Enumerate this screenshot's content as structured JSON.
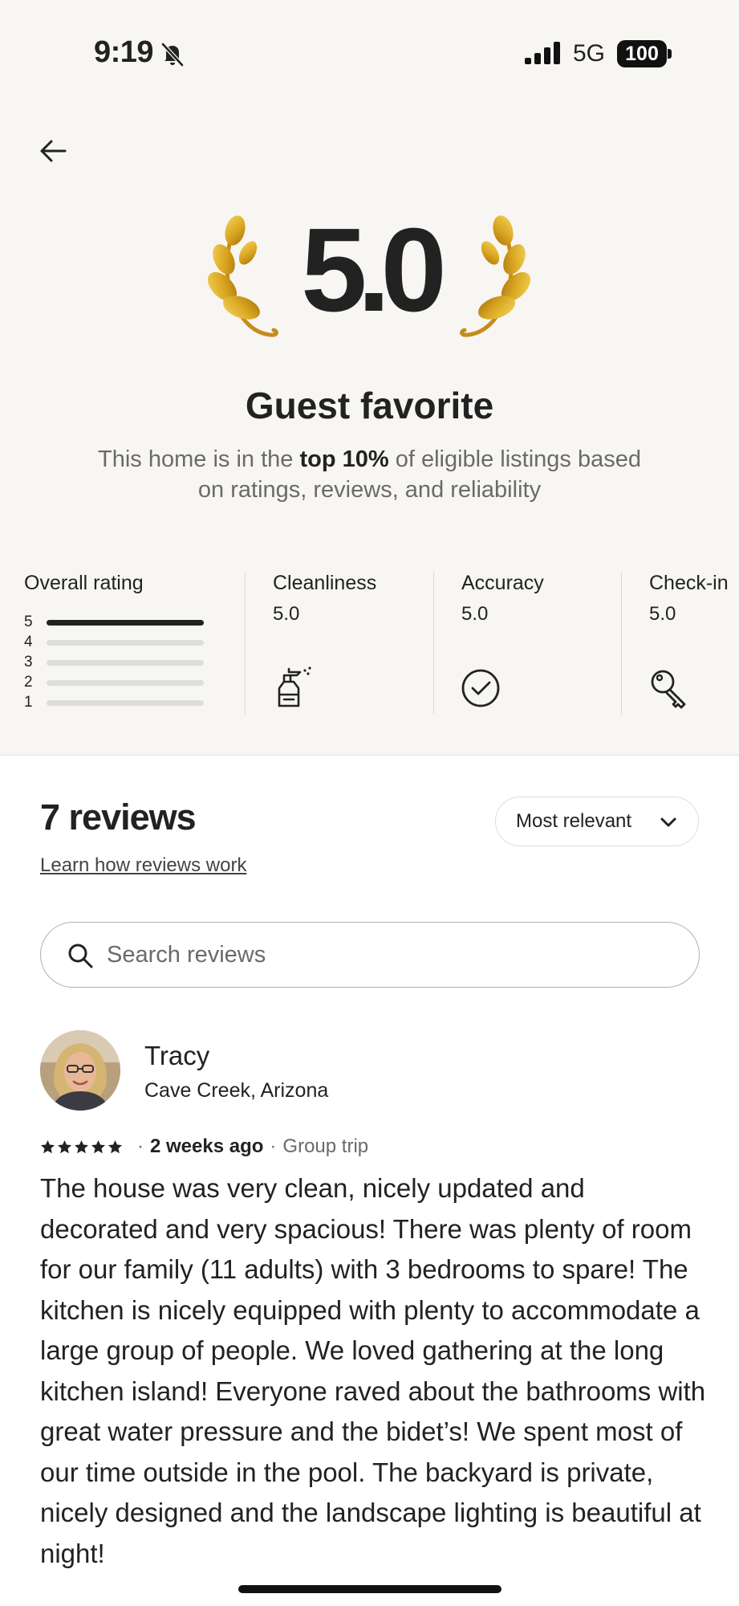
{
  "status_bar": {
    "time": "9:19",
    "network": "5G",
    "battery": "100"
  },
  "hero": {
    "rating": "5.0",
    "title": "Guest favorite",
    "desc_before": "This home is in the ",
    "desc_bold": "top 10%",
    "desc_after": " of eligible listings based on ratings, reviews, and reliability"
  },
  "ratings": {
    "overall_label": "Overall rating",
    "distribution": [
      {
        "stars": "5",
        "fraction": 1.0
      },
      {
        "stars": "4",
        "fraction": 0
      },
      {
        "stars": "3",
        "fraction": 0
      },
      {
        "stars": "2",
        "fraction": 0
      },
      {
        "stars": "1",
        "fraction": 0
      }
    ],
    "categories": [
      {
        "label": "Cleanliness",
        "value": "5.0",
        "icon": "spray-bottle-icon"
      },
      {
        "label": "Accuracy",
        "value": "5.0",
        "icon": "check-circle-icon"
      },
      {
        "label": "Check-in",
        "value": "5.0",
        "icon": "key-icon"
      }
    ]
  },
  "reviews": {
    "count_label": "7 reviews",
    "learn_link": "Learn how reviews work",
    "sort_label": "Most relevant",
    "search_placeholder": "Search reviews",
    "items": [
      {
        "name": "Tracy",
        "location": "Cave Creek, Arizona",
        "stars": 5,
        "when": "2 weeks ago",
        "trip_type": "Group trip",
        "text": "The house was very clean, nicely updated and decorated and very spacious! There was plenty of room for our family (11 adults) with 3 bedrooms to spare! The kitchen is nicely equipped with plenty to accommodate a large group of people. We loved gathering at the long kitchen island! Everyone raved about the bathrooms with great water pressure and the bidet’s! We spent most of our time outside in the pool. The backyard is private, nicely designed and the landscape lighting is beautiful at night!"
      }
    ]
  }
}
